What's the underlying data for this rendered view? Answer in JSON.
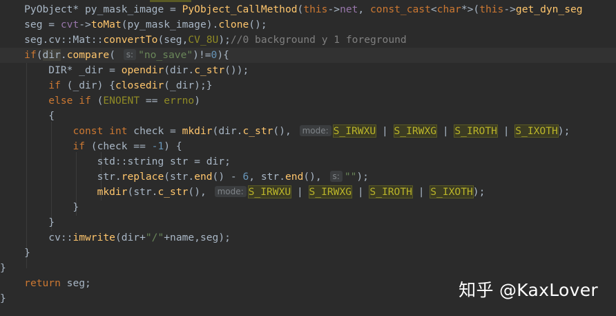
{
  "editor": {
    "lines": [
      [
        {
          "t": "    PyObject* py_mask_image = ",
          "c": "def"
        },
        {
          "t": "PyObject_CallMethod",
          "c": "fn"
        },
        {
          "t": "(",
          "c": "def"
        },
        {
          "t": "this",
          "c": "kw"
        },
        {
          "t": "->",
          "c": "def"
        },
        {
          "t": "net",
          "c": "fld"
        },
        {
          "t": ", ",
          "c": "def"
        },
        {
          "t": "const_cast",
          "c": "kw"
        },
        {
          "t": "<",
          "c": "def"
        },
        {
          "t": "char",
          "c": "kw"
        },
        {
          "t": "*>(",
          "c": "def"
        },
        {
          "t": "this",
          "c": "kw"
        },
        {
          "t": "->",
          "c": "def"
        },
        {
          "t": "get_dyn_seg",
          "c": "fn"
        }
      ],
      [
        {
          "t": "    seg = ",
          "c": "def"
        },
        {
          "t": "cvt",
          "c": "fld"
        },
        {
          "t": "->",
          "c": "def"
        },
        {
          "t": "toMat",
          "c": "fn"
        },
        {
          "t": "(py_mask_image).",
          "c": "def"
        },
        {
          "t": "clone",
          "c": "fn"
        },
        {
          "t": "();",
          "c": "def"
        }
      ],
      [
        {
          "t": "    seg.cv::Mat::",
          "c": "def"
        },
        {
          "t": "convertTo",
          "c": "fn"
        },
        {
          "t": "(seg,",
          "c": "def"
        },
        {
          "t": "CV_8U",
          "c": "mac"
        },
        {
          "t": ");",
          "c": "def"
        },
        {
          "t": "//0 background y 1 foreground",
          "c": "cm"
        }
      ],
      [
        {
          "t": "    ",
          "c": "def"
        },
        {
          "t": "if",
          "c": "kw"
        },
        {
          "t": "(",
          "c": "def"
        },
        {
          "t": "dir",
          "c": "var-hl"
        },
        {
          "t": ".",
          "c": "def"
        },
        {
          "t": "compare",
          "c": "fn"
        },
        {
          "t": "( ",
          "c": "def"
        },
        {
          "hint": "s:"
        },
        {
          "t": "\"no_save\"",
          "c": "str"
        },
        {
          "t": ")!=",
          "c": "def"
        },
        {
          "t": "0",
          "c": "num"
        },
        {
          "t": "){",
          "c": "def"
        }
      ],
      [
        {
          "t": "        DIR* _dir = ",
          "c": "def"
        },
        {
          "t": "opendir",
          "c": "fn"
        },
        {
          "t": "(dir.",
          "c": "def"
        },
        {
          "t": "c_str",
          "c": "fn"
        },
        {
          "t": "());",
          "c": "def"
        }
      ],
      [
        {
          "t": "        ",
          "c": "def"
        },
        {
          "t": "if",
          "c": "kw"
        },
        {
          "t": " (_dir) {",
          "c": "def"
        },
        {
          "t": "closedir",
          "c": "fn"
        },
        {
          "t": "(_dir);}",
          "c": "def"
        }
      ],
      [
        {
          "t": "        ",
          "c": "def"
        },
        {
          "t": "else if",
          "c": "kw"
        },
        {
          "t": " (",
          "c": "def"
        },
        {
          "t": "ENOENT",
          "c": "mac"
        },
        {
          "t": " == ",
          "c": "def"
        },
        {
          "t": "errno",
          "c": "mac"
        },
        {
          "t": ")",
          "c": "def"
        }
      ],
      [
        {
          "t": "        {",
          "c": "def"
        }
      ],
      [
        {
          "t": "            ",
          "c": "def"
        },
        {
          "t": "const int",
          "c": "kw"
        },
        {
          "t": " check = ",
          "c": "def"
        },
        {
          "t": "mkdir",
          "c": "fn"
        },
        {
          "t": "(dir.",
          "c": "def"
        },
        {
          "t": "c_str",
          "c": "fn"
        },
        {
          "t": "(), ",
          "c": "def"
        },
        {
          "hint": "mode:"
        },
        {
          "t": "S_IRWXU",
          "c": "mac-hl"
        },
        {
          "t": " | ",
          "c": "def"
        },
        {
          "t": "S_IRWXG",
          "c": "mac-hl"
        },
        {
          "t": " | ",
          "c": "def"
        },
        {
          "t": "S_IROTH",
          "c": "mac-hl"
        },
        {
          "t": " | ",
          "c": "def"
        },
        {
          "t": "S_IXOTH",
          "c": "mac-hl"
        },
        {
          "t": ");",
          "c": "def"
        }
      ],
      [
        {
          "t": "            ",
          "c": "def"
        },
        {
          "t": "if",
          "c": "kw"
        },
        {
          "t": " (check == ",
          "c": "def"
        },
        {
          "t": "-1",
          "c": "num"
        },
        {
          "t": ") {",
          "c": "def"
        }
      ],
      [
        {
          "t": "                std::string str = dir;",
          "c": "def"
        }
      ],
      [
        {
          "t": "                str.",
          "c": "def"
        },
        {
          "t": "replace",
          "c": "fn"
        },
        {
          "t": "(str.",
          "c": "def"
        },
        {
          "t": "end",
          "c": "fn"
        },
        {
          "t": "() - ",
          "c": "def"
        },
        {
          "t": "6",
          "c": "num"
        },
        {
          "t": ", str.",
          "c": "def"
        },
        {
          "t": "end",
          "c": "fn"
        },
        {
          "t": "(), ",
          "c": "def"
        },
        {
          "hint": "s:"
        },
        {
          "t": "\"\"",
          "c": "str"
        },
        {
          "t": ");",
          "c": "def"
        }
      ],
      [
        {
          "t": "                ",
          "c": "def"
        },
        {
          "t": "mkdir",
          "c": "fn"
        },
        {
          "t": "(str.",
          "c": "def"
        },
        {
          "t": "c_str",
          "c": "fn"
        },
        {
          "t": "(), ",
          "c": "def"
        },
        {
          "hint": "mode:"
        },
        {
          "t": "S_IRWXU",
          "c": "mac-hl"
        },
        {
          "t": " | ",
          "c": "def"
        },
        {
          "t": "S_IRWXG",
          "c": "mac-hl"
        },
        {
          "t": " | ",
          "c": "def"
        },
        {
          "t": "S_IROTH",
          "c": "mac-hl"
        },
        {
          "t": " | ",
          "c": "def"
        },
        {
          "t": "S_IXOTH",
          "c": "mac-hl"
        },
        {
          "t": ");",
          "c": "def"
        }
      ],
      [
        {
          "t": "            }",
          "c": "def"
        }
      ],
      [
        {
          "t": "        }",
          "c": "def"
        }
      ],
      [
        {
          "t": "        cv::",
          "c": "def"
        },
        {
          "t": "imwrite",
          "c": "fn"
        },
        {
          "t": "(dir+",
          "c": "def"
        },
        {
          "t": "\"/\"",
          "c": "str"
        },
        {
          "t": "+name,seg);",
          "c": "def"
        }
      ],
      [
        {
          "t": "    }",
          "c": "def"
        }
      ],
      [
        {
          "t": "}",
          "c": "def"
        }
      ],
      [
        {
          "t": "    ",
          "c": "def"
        },
        {
          "t": "return",
          "c": "kw"
        },
        {
          "t": " seg;",
          "c": "def"
        }
      ],
      [
        {
          "t": "}",
          "c": "def"
        }
      ]
    ],
    "current_line_index": 3,
    "colors": {
      "background": "#2b2b2b",
      "keyword": "#cc7832",
      "function": "#ffc66d",
      "string": "#6a8759",
      "number": "#6897bb",
      "comment": "#808080",
      "macro": "#908b25",
      "field": "#9876aa",
      "text": "#a9b7c6"
    }
  },
  "watermark": {
    "text": "知乎 @KaxLover"
  }
}
